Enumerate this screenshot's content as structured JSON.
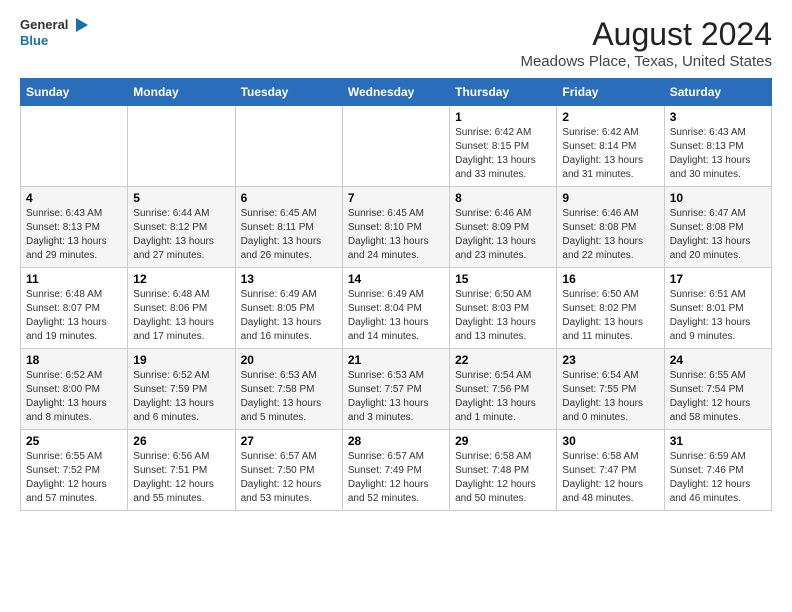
{
  "header": {
    "logo_line1": "General",
    "logo_line2": "Blue",
    "title": "August 2024",
    "subtitle": "Meadows Place, Texas, United States"
  },
  "calendar": {
    "days_of_week": [
      "Sunday",
      "Monday",
      "Tuesday",
      "Wednesday",
      "Thursday",
      "Friday",
      "Saturday"
    ],
    "weeks": [
      [
        {
          "day": "",
          "detail": ""
        },
        {
          "day": "",
          "detail": ""
        },
        {
          "day": "",
          "detail": ""
        },
        {
          "day": "",
          "detail": ""
        },
        {
          "day": "1",
          "detail": "Sunrise: 6:42 AM\nSunset: 8:15 PM\nDaylight: 13 hours\nand 33 minutes."
        },
        {
          "day": "2",
          "detail": "Sunrise: 6:42 AM\nSunset: 8:14 PM\nDaylight: 13 hours\nand 31 minutes."
        },
        {
          "day": "3",
          "detail": "Sunrise: 6:43 AM\nSunset: 8:13 PM\nDaylight: 13 hours\nand 30 minutes."
        }
      ],
      [
        {
          "day": "4",
          "detail": "Sunrise: 6:43 AM\nSunset: 8:13 PM\nDaylight: 13 hours\nand 29 minutes."
        },
        {
          "day": "5",
          "detail": "Sunrise: 6:44 AM\nSunset: 8:12 PM\nDaylight: 13 hours\nand 27 minutes."
        },
        {
          "day": "6",
          "detail": "Sunrise: 6:45 AM\nSunset: 8:11 PM\nDaylight: 13 hours\nand 26 minutes."
        },
        {
          "day": "7",
          "detail": "Sunrise: 6:45 AM\nSunset: 8:10 PM\nDaylight: 13 hours\nand 24 minutes."
        },
        {
          "day": "8",
          "detail": "Sunrise: 6:46 AM\nSunset: 8:09 PM\nDaylight: 13 hours\nand 23 minutes."
        },
        {
          "day": "9",
          "detail": "Sunrise: 6:46 AM\nSunset: 8:08 PM\nDaylight: 13 hours\nand 22 minutes."
        },
        {
          "day": "10",
          "detail": "Sunrise: 6:47 AM\nSunset: 8:08 PM\nDaylight: 13 hours\nand 20 minutes."
        }
      ],
      [
        {
          "day": "11",
          "detail": "Sunrise: 6:48 AM\nSunset: 8:07 PM\nDaylight: 13 hours\nand 19 minutes."
        },
        {
          "day": "12",
          "detail": "Sunrise: 6:48 AM\nSunset: 8:06 PM\nDaylight: 13 hours\nand 17 minutes."
        },
        {
          "day": "13",
          "detail": "Sunrise: 6:49 AM\nSunset: 8:05 PM\nDaylight: 13 hours\nand 16 minutes."
        },
        {
          "day": "14",
          "detail": "Sunrise: 6:49 AM\nSunset: 8:04 PM\nDaylight: 13 hours\nand 14 minutes."
        },
        {
          "day": "15",
          "detail": "Sunrise: 6:50 AM\nSunset: 8:03 PM\nDaylight: 13 hours\nand 13 minutes."
        },
        {
          "day": "16",
          "detail": "Sunrise: 6:50 AM\nSunset: 8:02 PM\nDaylight: 13 hours\nand 11 minutes."
        },
        {
          "day": "17",
          "detail": "Sunrise: 6:51 AM\nSunset: 8:01 PM\nDaylight: 13 hours\nand 9 minutes."
        }
      ],
      [
        {
          "day": "18",
          "detail": "Sunrise: 6:52 AM\nSunset: 8:00 PM\nDaylight: 13 hours\nand 8 minutes."
        },
        {
          "day": "19",
          "detail": "Sunrise: 6:52 AM\nSunset: 7:59 PM\nDaylight: 13 hours\nand 6 minutes."
        },
        {
          "day": "20",
          "detail": "Sunrise: 6:53 AM\nSunset: 7:58 PM\nDaylight: 13 hours\nand 5 minutes."
        },
        {
          "day": "21",
          "detail": "Sunrise: 6:53 AM\nSunset: 7:57 PM\nDaylight: 13 hours\nand 3 minutes."
        },
        {
          "day": "22",
          "detail": "Sunrise: 6:54 AM\nSunset: 7:56 PM\nDaylight: 13 hours\nand 1 minute."
        },
        {
          "day": "23",
          "detail": "Sunrise: 6:54 AM\nSunset: 7:55 PM\nDaylight: 13 hours\nand 0 minutes."
        },
        {
          "day": "24",
          "detail": "Sunrise: 6:55 AM\nSunset: 7:54 PM\nDaylight: 12 hours\nand 58 minutes."
        }
      ],
      [
        {
          "day": "25",
          "detail": "Sunrise: 6:55 AM\nSunset: 7:52 PM\nDaylight: 12 hours\nand 57 minutes."
        },
        {
          "day": "26",
          "detail": "Sunrise: 6:56 AM\nSunset: 7:51 PM\nDaylight: 12 hours\nand 55 minutes."
        },
        {
          "day": "27",
          "detail": "Sunrise: 6:57 AM\nSunset: 7:50 PM\nDaylight: 12 hours\nand 53 minutes."
        },
        {
          "day": "28",
          "detail": "Sunrise: 6:57 AM\nSunset: 7:49 PM\nDaylight: 12 hours\nand 52 minutes."
        },
        {
          "day": "29",
          "detail": "Sunrise: 6:58 AM\nSunset: 7:48 PM\nDaylight: 12 hours\nand 50 minutes."
        },
        {
          "day": "30",
          "detail": "Sunrise: 6:58 AM\nSunset: 7:47 PM\nDaylight: 12 hours\nand 48 minutes."
        },
        {
          "day": "31",
          "detail": "Sunrise: 6:59 AM\nSunset: 7:46 PM\nDaylight: 12 hours\nand 46 minutes."
        }
      ]
    ]
  }
}
